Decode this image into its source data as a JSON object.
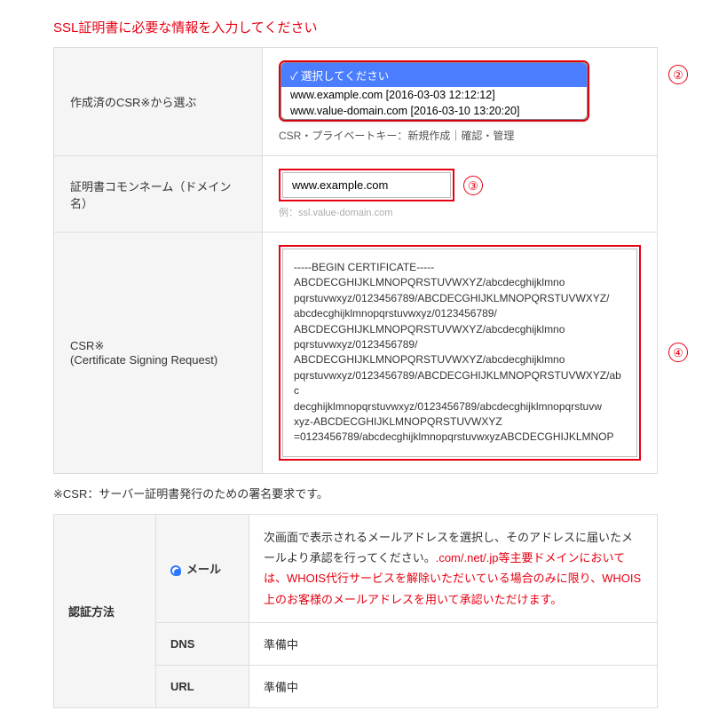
{
  "header": "SSL証明書に必要な情報を入力してください",
  "csr_row": {
    "label": "作成済のCSR※から選ぶ",
    "dropdown": {
      "selected": "選択してください",
      "option1": "www.example.com [2016-03-03 12:12:12]",
      "option2": "www.value-domain.com [2016-03-10 13:20:20]"
    },
    "under": "CSR・プライベートキー：新規作成｜確認・管理"
  },
  "common_name_row": {
    "label": "証明書コモンネーム（ドメイン名）",
    "value": "www.example.com",
    "example": "例：ssl.value-domain.com"
  },
  "csr_text_row": {
    "label1": "CSR※",
    "label2": "(Certificate Signing Request)",
    "content": "-----BEGIN CERTIFICATE-----\nABCDECGHIJKLMNOPQRSTUVWXYZ/abcdecghijklmno\npqrstuvwxyz/0123456789/ABCDECGHIJKLMNOPQRSTUVWXYZ/\nabcdecghijklmnopqrstuvwxyz/0123456789/\nABCDECGHIJKLMNOPQRSTUVWXYZ/abcdecghijklmno\npqrstuvwxyz/0123456789/\nABCDECGHIJKLMNOPQRSTUVWXYZ/abcdecghijklmno\npqrstuvwxyz/0123456789/ABCDECGHIJKLMNOPQRSTUVWXYZ/abc\ndecghijklmnopqrstuvwxyz/0123456789/abcdecghijklmnopqrstuvw\nxyz-ABCDECGHIJKLMNOPQRSTUVWXYZ\n=0123456789/abcdecghijklmnopqrstuvwxyzABCDECGHIJKLMNOP"
  },
  "note": "※CSR：サーバー証明書発行のための署名要求です。",
  "auth": {
    "label": "認証方法",
    "mail": {
      "label": "メール",
      "text1": "次画面で表示されるメールアドレスを選択し、そのアドレスに届いたメールより承認を行ってください。",
      "text2": ".com/.net/.jp等主要ドメインにおいては、WHOIS代行サービスを解除いただいている場合のみに限り、WHOIS上のお客様のメールアドレスを用いて承認いただけます。"
    },
    "dns": {
      "label": "DNS",
      "value": "準備中"
    },
    "url": {
      "label": "URL",
      "value": "準備中"
    }
  },
  "badges": {
    "b2": "②",
    "b3": "③",
    "b4": "④"
  }
}
